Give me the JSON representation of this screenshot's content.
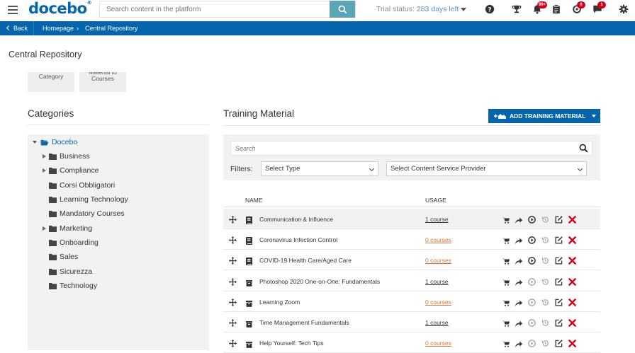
{
  "header": {
    "logo": "docebo",
    "logo_mark": "®",
    "search_placeholder": "Search content in the platform",
    "trial_label": "Trial status:",
    "trial_days": "283 days left",
    "badges": {
      "notifications": "99+",
      "tasks": "6",
      "messages": "1"
    }
  },
  "breadcrumb": {
    "back": "Back",
    "home": "Homepage",
    "current": "Central Repository"
  },
  "page_title": "Central Repository",
  "tiles": [
    {
      "label": "Category"
    },
    {
      "label": "Material to Courses"
    }
  ],
  "categories": {
    "heading": "Categories",
    "root": "Docebo",
    "items": [
      {
        "label": "Business",
        "expandable": true
      },
      {
        "label": "Compliance",
        "expandable": true
      },
      {
        "label": "Corsi Obbligatori",
        "expandable": false
      },
      {
        "label": "Learning Technology",
        "expandable": false
      },
      {
        "label": "Mandatory Courses",
        "expandable": false
      },
      {
        "label": "Marketing",
        "expandable": true
      },
      {
        "label": "Onboarding",
        "expandable": false
      },
      {
        "label": "Sales",
        "expandable": false
      },
      {
        "label": "Sicurezza",
        "expandable": false
      },
      {
        "label": "Technology",
        "expandable": false
      }
    ]
  },
  "training": {
    "heading": "Training Material",
    "add_button": "ADD TRAINING MATERIAL",
    "search_placeholder": "Search",
    "filters_label": "Filters:",
    "select_type": "Select Type",
    "select_csp": "Select Content Service Provider",
    "col_name": "NAME",
    "col_usage": "USAGE",
    "rows": [
      {
        "name": "Communication & Influence",
        "usage": "1 course",
        "type": "book",
        "play_active": true
      },
      {
        "name": "Coronavirus Infection Control",
        "usage": "0 courses",
        "type": "book",
        "play_active": true
      },
      {
        "name": "COVID-19 Health Care/Aged Care",
        "usage": "0 courses",
        "type": "book",
        "play_active": true
      },
      {
        "name": "Photoshop 2020 One-on-One: Fundamentals",
        "usage": "1 course",
        "type": "box",
        "play_active": false
      },
      {
        "name": "Learning Zoom",
        "usage": "0 courses",
        "type": "box",
        "play_active": false
      },
      {
        "name": "Time Management Fundamentals",
        "usage": "1 course",
        "type": "box",
        "play_active": false
      },
      {
        "name": "Help Yourself: Tech Tips",
        "usage": "0 courses",
        "type": "box",
        "play_active": false
      }
    ]
  },
  "colors": {
    "brand": "#0465ac",
    "search_button": "#5aa6b5",
    "zero_usage": "#e0733a",
    "delete": "#d0021b"
  }
}
